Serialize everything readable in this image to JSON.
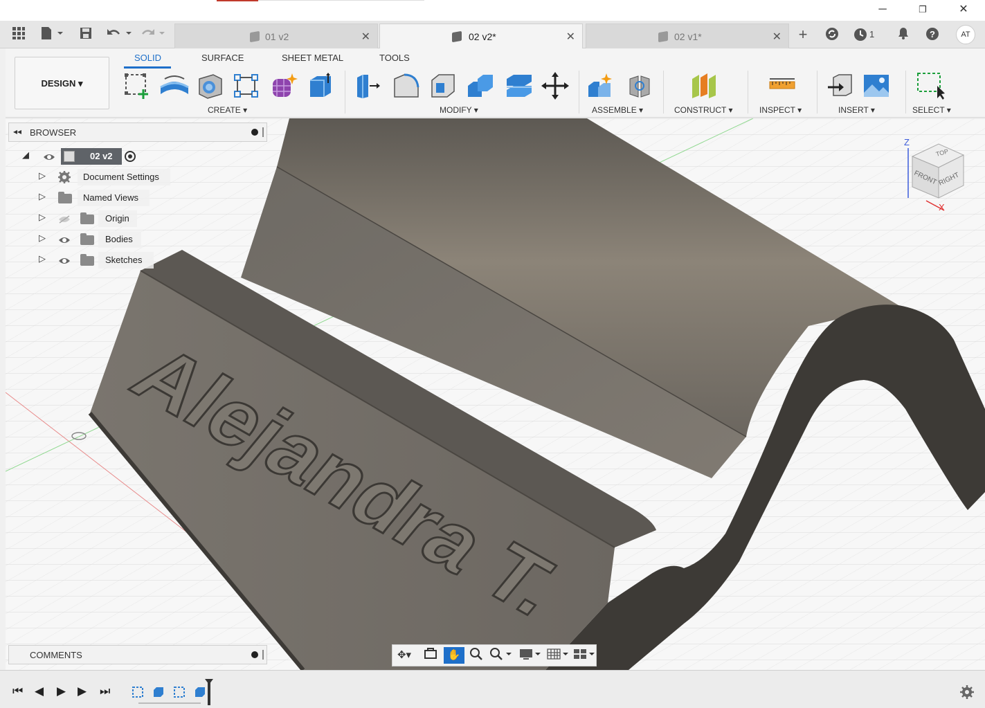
{
  "window": {
    "minimize": "─",
    "restore": "❐",
    "close": "✕"
  },
  "tabbar": {
    "tabs": [
      {
        "label": "01 v2",
        "active": false
      },
      {
        "label": "02 v2*",
        "active": true
      },
      {
        "label": "02 v1*",
        "active": false
      }
    ],
    "job_count": "1",
    "user_initials": "AT"
  },
  "ribbon": {
    "workspace": "DESIGN",
    "tabs": [
      "SOLID",
      "SURFACE",
      "SHEET METAL",
      "TOOLS"
    ],
    "groups": [
      "CREATE",
      "MODIFY",
      "ASSEMBLE",
      "CONSTRUCT",
      "INSPECT",
      "INSERT",
      "SELECT"
    ]
  },
  "browser": {
    "title": "BROWSER",
    "root": "02 v2",
    "items": [
      {
        "label": "Document Settings",
        "icon": "gear-icon",
        "visible": null
      },
      {
        "label": "Named Views",
        "icon": "folder-icon",
        "visible": null
      },
      {
        "label": "Origin",
        "icon": "folder-icon",
        "visible": false
      },
      {
        "label": "Bodies",
        "icon": "folder-icon",
        "visible": true
      },
      {
        "label": "Sketches",
        "icon": "folder-icon",
        "visible": true
      }
    ]
  },
  "viewport": {
    "model_text": "Alejandra T.",
    "viewcube": {
      "top": "TOP",
      "front": "FRONT",
      "right": "RIGHT",
      "axis_z": "Z",
      "axis_x": "X"
    }
  },
  "comments": {
    "title": "COMMENTS"
  },
  "colors": {
    "accent": "#1e6fc9",
    "model": "#6f6a63",
    "grid": "#d5d5d5"
  }
}
